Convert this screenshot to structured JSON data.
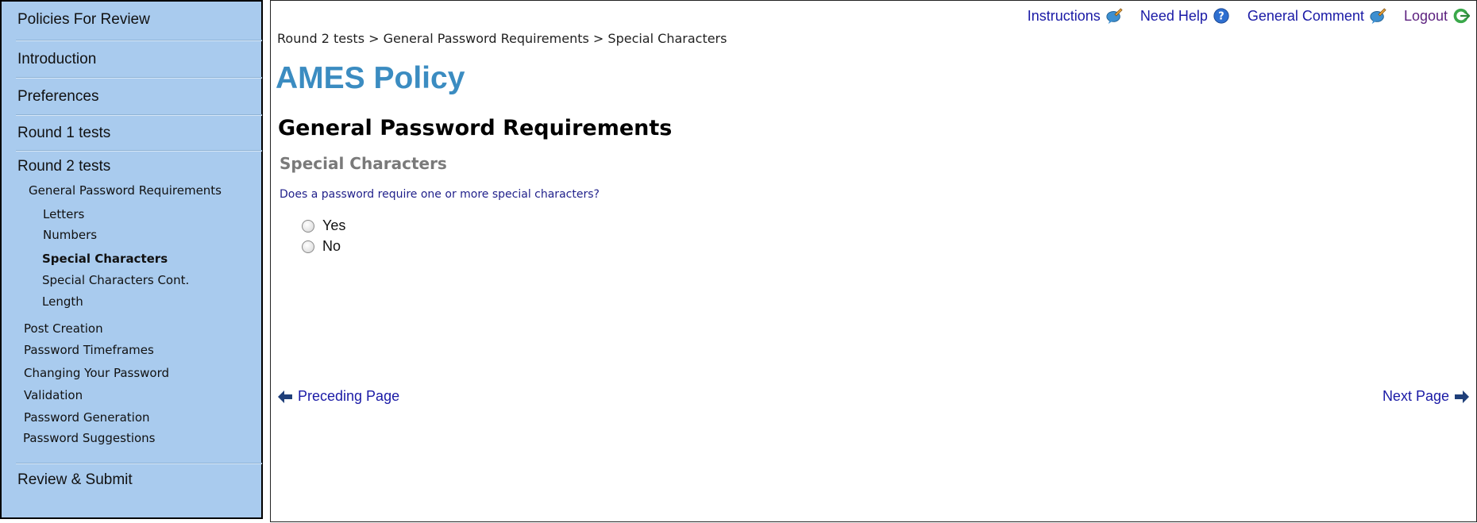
{
  "sidebar": {
    "top_items": [
      "Policies For Review",
      "Introduction",
      "Preferences",
      "Round 1 tests",
      "Round 2 tests"
    ],
    "round2_group": "General Password Requirements",
    "round2_subitems": [
      "Letters",
      "Numbers",
      "Special Characters",
      "Special Characters Cont.",
      "Length"
    ],
    "other_sections": [
      "Post Creation",
      "Password Timeframes",
      "Changing Your Password",
      "Validation",
      "Password Generation",
      "Password Suggestions"
    ],
    "review_submit": "Review & Submit",
    "active_item": "Special Characters"
  },
  "header": {
    "instructions": "Instructions",
    "need_help": "Need Help",
    "general_comment": "General Comment",
    "logout": "Logout"
  },
  "breadcrumb": [
    "Round 2 tests",
    "General Password Requirements",
    "Special Characters"
  ],
  "breadcrumb_separator": " > ",
  "page": {
    "app_title": "AMES Policy",
    "section_title": "General Password Requirements",
    "subsection_title": "Special Characters",
    "question": "Does a password require one or more special characters?",
    "options": [
      "Yes",
      "No"
    ],
    "selected_option": null
  },
  "nav": {
    "prev": "Preceding Page",
    "next": "Next Page"
  },
  "colors": {
    "sidebar_bg": "#a9cbee",
    "title_blue": "#3b8cc1",
    "link_blue": "#1a1aa6",
    "logout_purple": "#5b1f7e",
    "arrow_navy": "#1f3f7a"
  },
  "icons": [
    "comment-icon",
    "help-icon",
    "comment-icon",
    "logout-icon",
    "arrow-left-icon",
    "arrow-right-icon"
  ]
}
